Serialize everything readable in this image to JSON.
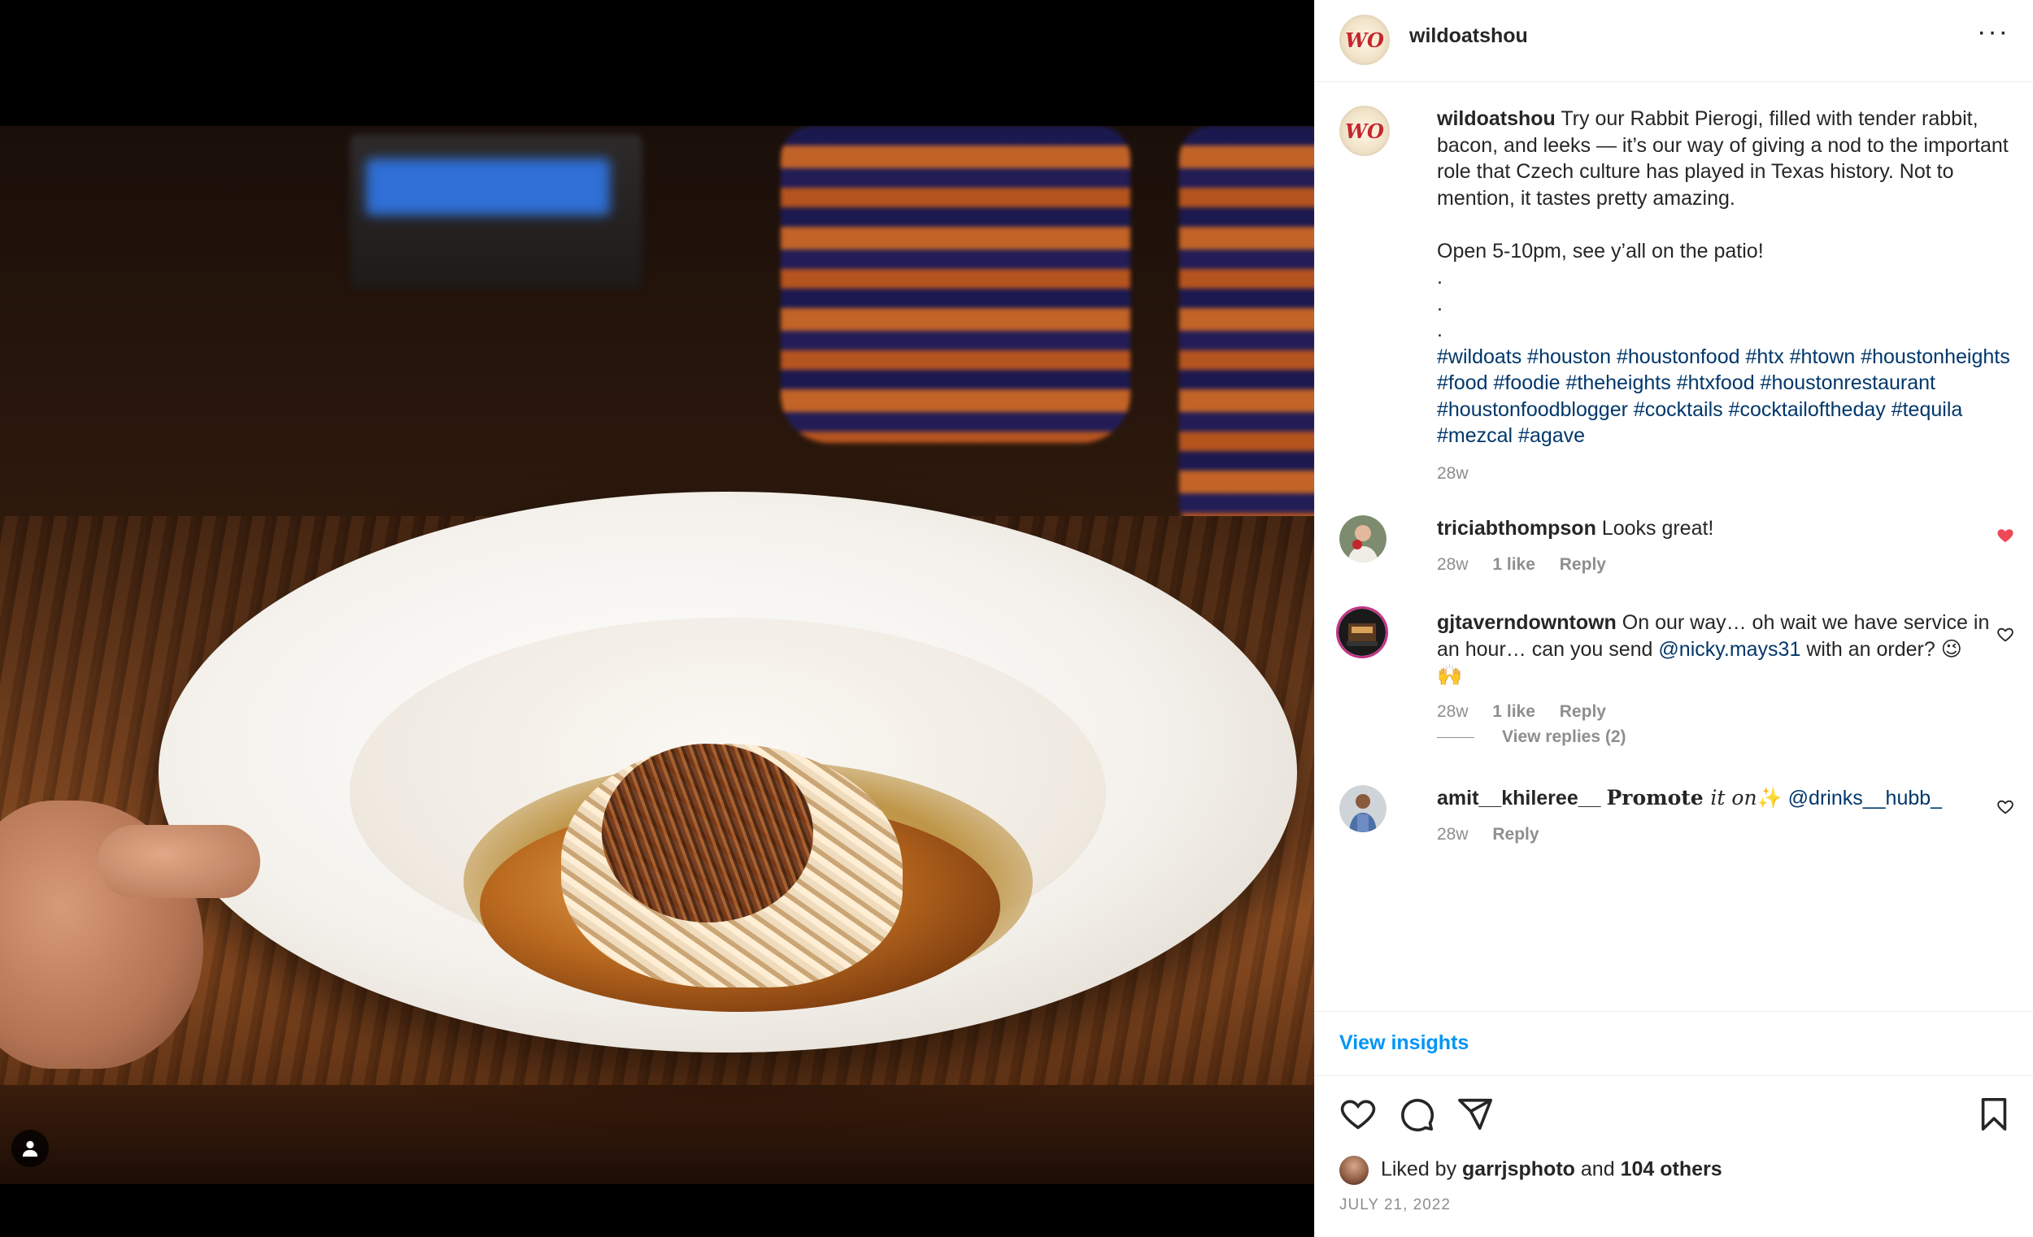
{
  "post": {
    "username": "wildoatshou",
    "logo_text": "WO",
    "more_label": "···"
  },
  "caption": {
    "username": "wildoatshou",
    "lines": [
      "Try our Rabbit Pierogi, filled with tender rabbit, bacon, and leeks — it’s our way of giving a nod to the important role that Czech culture has played in Texas history. Not to mention, it tastes pretty amazing."
    ],
    "line2": "Open 5-10pm, see y’all on the patio!",
    "dots": [
      ".",
      ".",
      "."
    ],
    "hashtags": "#wildoats #houston #houstonfood #htx #htown #houstonheights #food #foodie #theheights #htxfood #houstonrestaurant #houstonfoodblogger #cocktails #cocktailoftheday #tequila #mezcal #agave",
    "time": "28w"
  },
  "comments": [
    {
      "username": "triciabthompson",
      "text": "Looks great!",
      "time": "28w",
      "likes": "1 like",
      "reply": "Reply",
      "liked": true
    },
    {
      "username": "gjtaverndowntown",
      "text_before": "On our way… oh wait we have service in an hour… can you send ",
      "mention": "@nicky.mays31",
      "text_after": " with an order? 😉 🙌",
      "time": "28w",
      "likes": "1 like",
      "reply": "Reply",
      "liked": false,
      "view_replies": "View replies (2)"
    },
    {
      "username": "amit__khileree__",
      "promote_bold": "Promote ",
      "promote_italic": "it on",
      "sparkle": "✨",
      "mention": "@drinks__hubb_",
      "time": "28w",
      "reply": "Reply",
      "liked": false
    }
  ],
  "insights": {
    "label": "View insights"
  },
  "actions": {
    "icons": [
      "heart-icon",
      "comment-icon",
      "share-icon",
      "save-icon"
    ]
  },
  "likes": {
    "prefix": "Liked by",
    "user": "garrjsphoto",
    "and": "and",
    "others": "104 others"
  },
  "date": "JULY 21, 2022",
  "colors": {
    "link_blue": "#0095f6",
    "hashtag": "#00376b",
    "muted": "#8e8e8e",
    "like_red": "#ed4956"
  }
}
